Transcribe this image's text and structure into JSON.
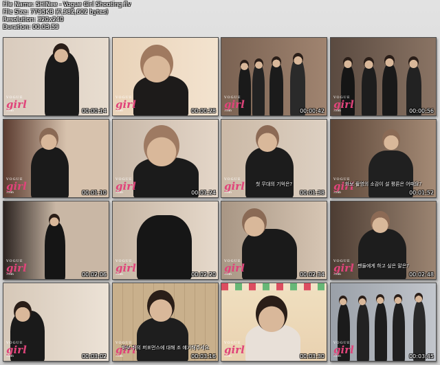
{
  "header": {
    "file_name": "File Name: SHINee - Vogue Girl Shooting.flv",
    "file_size": "File Size: 7795KB (7,982,602 bytes)",
    "resolution": "Resolution: 320x240",
    "duration": "Duration: 00:03:59"
  },
  "logo": {
    "vogue": "VOGUE",
    "girl": "girl",
    "com": ".com"
  },
  "thumbnails": [
    {
      "timestamp": "00:00:14",
      "subtitle": ""
    },
    {
      "timestamp": "00:00:28",
      "subtitle": ""
    },
    {
      "timestamp": "00:00:42",
      "subtitle": ""
    },
    {
      "timestamp": "00:00:56",
      "subtitle": ""
    },
    {
      "timestamp": "00:01:10",
      "subtitle": ""
    },
    {
      "timestamp": "00:01:24",
      "subtitle": ""
    },
    {
      "timestamp": "00:01:38",
      "subtitle": "첫 무대의 기억은?"
    },
    {
      "timestamp": "00:01:52",
      "subtitle": "화보 촬영의 소감이 설 평론은 어때요?"
    },
    {
      "timestamp": "00:02:06",
      "subtitle": ""
    },
    {
      "timestamp": "00:02:20",
      "subtitle": ""
    },
    {
      "timestamp": "00:02:34",
      "subtitle": ""
    },
    {
      "timestamp": "00:02:48",
      "subtitle": "팬들에게 하고 싶은 말은?"
    },
    {
      "timestamp": "00:03:02",
      "subtitle": ""
    },
    {
      "timestamp": "00:03:16",
      "subtitle": "화보 취의 퍼포먼스에 대해 조 얘기해주세요"
    },
    {
      "timestamp": "00:03:30",
      "subtitle": ""
    },
    {
      "timestamp": "00:03:45",
      "subtitle": ""
    }
  ]
}
